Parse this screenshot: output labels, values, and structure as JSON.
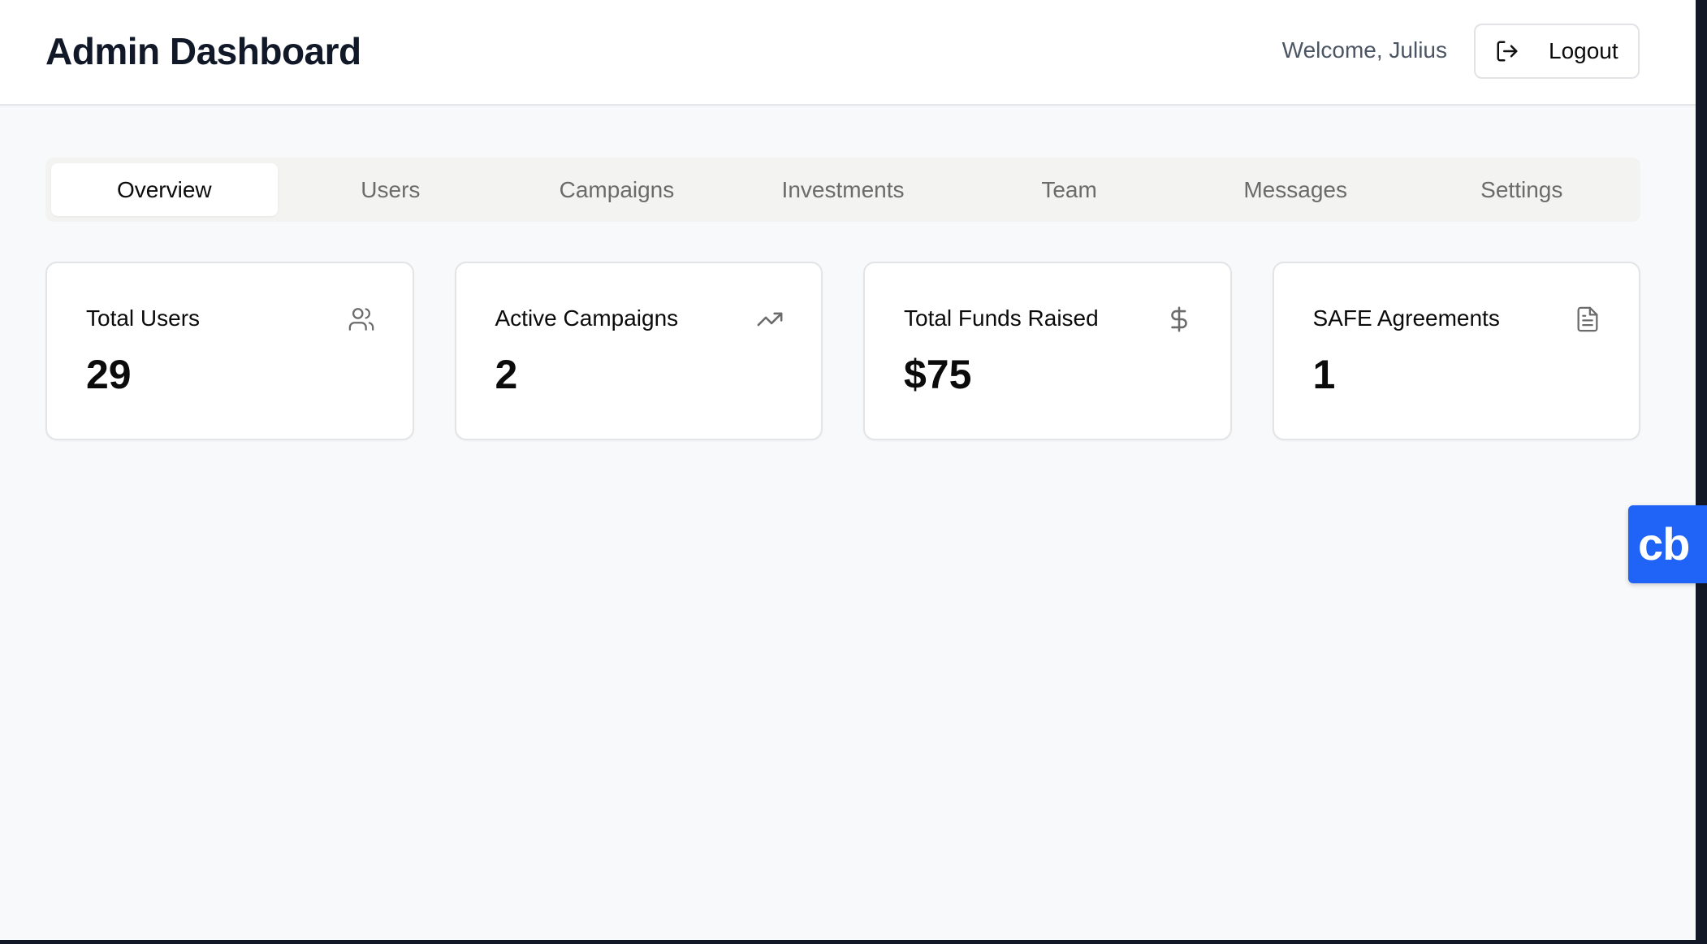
{
  "header": {
    "title": "Admin Dashboard",
    "welcome": "Welcome, Julius",
    "logout_label": "Logout"
  },
  "tabs": [
    {
      "label": "Overview",
      "active": true
    },
    {
      "label": "Users",
      "active": false
    },
    {
      "label": "Campaigns",
      "active": false
    },
    {
      "label": "Investments",
      "active": false
    },
    {
      "label": "Team",
      "active": false
    },
    {
      "label": "Messages",
      "active": false
    },
    {
      "label": "Settings",
      "active": false
    }
  ],
  "stats": [
    {
      "title": "Total Users",
      "value": "29",
      "icon": "users-icon"
    },
    {
      "title": "Active Campaigns",
      "value": "2",
      "icon": "trending-up-icon"
    },
    {
      "title": "Total Funds Raised",
      "value": "$75",
      "icon": "dollar-icon"
    },
    {
      "title": "SAFE Agreements",
      "value": "1",
      "icon": "document-icon"
    }
  ],
  "widget": {
    "label": "cb",
    "color": "#1f64f6"
  },
  "colors": {
    "page_bg": "#f8f9fb",
    "title_text": "#111827",
    "muted_text": "#6b6b6b",
    "frame_dark": "#131826"
  }
}
